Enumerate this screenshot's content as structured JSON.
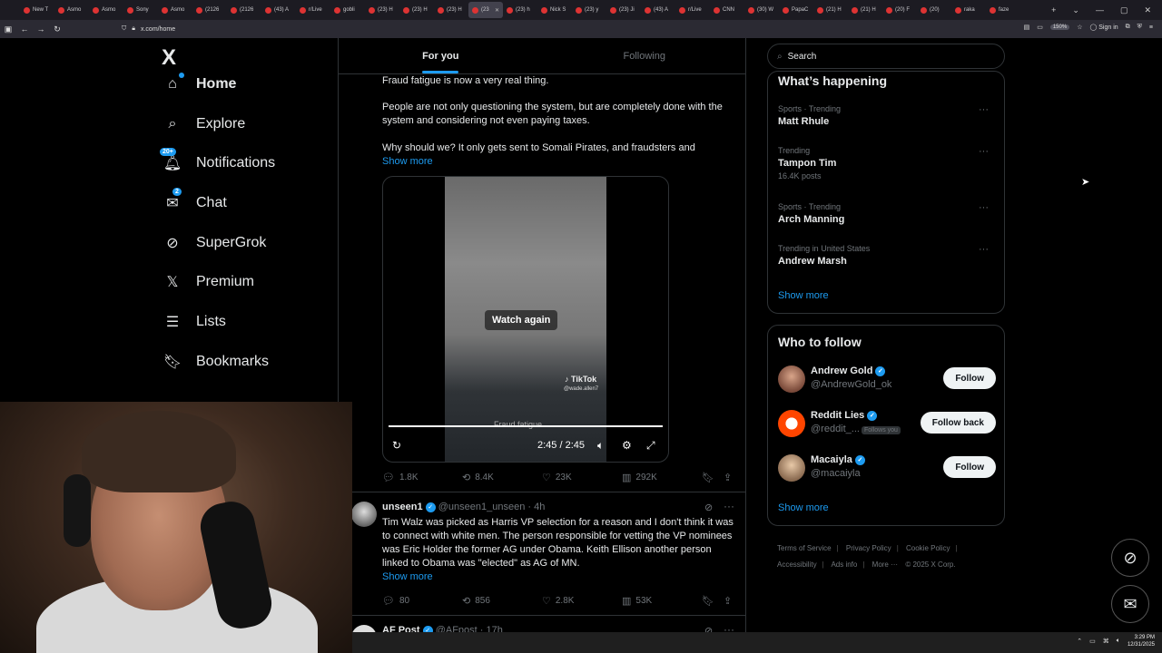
{
  "browser": {
    "tabs": [
      {
        "label": "New T",
        "active": false
      },
      {
        "label": "Asmo",
        "active": false
      },
      {
        "label": "Asmo",
        "active": false
      },
      {
        "label": "Sony",
        "active": false
      },
      {
        "label": "Asmo",
        "active": false
      },
      {
        "label": "(2126",
        "active": false
      },
      {
        "label": "(2126",
        "active": false
      },
      {
        "label": "(43) A",
        "active": false
      },
      {
        "label": "r/Live",
        "active": false
      },
      {
        "label": "gobli",
        "active": false
      },
      {
        "label": "(23) H",
        "active": false
      },
      {
        "label": "(23) H",
        "active": false
      },
      {
        "label": "(23) H",
        "active": false
      },
      {
        "label": "(23",
        "active": true
      },
      {
        "label": "(23) h",
        "active": false
      },
      {
        "label": "Nick S",
        "active": false
      },
      {
        "label": "(23) y",
        "active": false
      },
      {
        "label": "(23) Ji",
        "active": false
      },
      {
        "label": "(43) A",
        "active": false
      },
      {
        "label": "r/Live",
        "active": false
      },
      {
        "label": "CNN",
        "active": false
      },
      {
        "label": "(30) W",
        "active": false
      },
      {
        "label": "PapaC",
        "active": false
      },
      {
        "label": "(21) H",
        "active": false
      },
      {
        "label": "(21) H",
        "active": false
      },
      {
        "label": "(20) F",
        "active": false
      },
      {
        "label": "(20)",
        "active": false
      },
      {
        "label": "raka",
        "active": false
      },
      {
        "label": "faze",
        "active": false
      }
    ],
    "url": "x.com/home",
    "zoom": "150%",
    "sign_in": "Sign in"
  },
  "nav": {
    "logo": "X",
    "items": [
      {
        "label": "Home",
        "icon": "home-icon",
        "glyph": "⌂"
      },
      {
        "label": "Explore",
        "icon": "search-icon",
        "glyph": "⌕"
      },
      {
        "label": "Notifications",
        "icon": "bell-icon",
        "glyph": "🔔︎",
        "badge": "20+"
      },
      {
        "label": "Chat",
        "icon": "mail-icon",
        "glyph": "✉",
        "badge": "2"
      },
      {
        "label": "SuperGrok",
        "icon": "grok-icon",
        "glyph": "⊘"
      },
      {
        "label": "Premium",
        "icon": "x-premium-icon",
        "glyph": "𝕏"
      },
      {
        "label": "Lists",
        "icon": "list-icon",
        "glyph": "☰"
      },
      {
        "label": "Bookmarks",
        "icon": "bookmark-icon",
        "glyph": "🔖︎"
      }
    ]
  },
  "feed": {
    "tabs": [
      "For you",
      "Following"
    ],
    "tweet1": {
      "lines": [
        "Fraud fatigue is now a very real thing.",
        "People are not only questioning the system, but are completely done with the system and considering not even paying taxes.",
        "Why should we? It only gets sent to Somali Pirates, and fraudsters and"
      ],
      "show_more": "Show more",
      "video": {
        "watch_again": "Watch again",
        "caption": "Fraud fatigue.",
        "tiktok": "TikTok",
        "tiktok_handle": "@wade.allen7",
        "time": "2:45 / 2:45"
      },
      "stats": {
        "replies": "1.8K",
        "reposts": "8.4K",
        "likes": "23K",
        "views": "292K"
      }
    },
    "tweet2": {
      "name": "unseen1",
      "handle": "@unseen1_unseen",
      "time": "· 4h",
      "text": "Tim Walz was picked as Harris VP selection for a reason and I don't think it was to connect with white men.   The person responsible for vetting the VP nominees was Eric Holder  the former AG under Obama. Keith Ellison another person linked to Obama was \"elected\" as AG of MN.",
      "show_more": "Show more",
      "stats": {
        "replies": "80",
        "reposts": "856",
        "likes": "2.8K",
        "views": "53K"
      }
    },
    "tweet3": {
      "name": "AF Post",
      "handle": "@AFpost",
      "time": "· 17h"
    }
  },
  "sidebar": {
    "search_placeholder": "Search",
    "whats_happening": {
      "title": "What’s happening",
      "trends": [
        {
          "meta": "Sports · Trending",
          "topic": "Matt Rhule",
          "count": ""
        },
        {
          "meta": "Trending",
          "topic": "Tampon Tim",
          "count": "16.4K posts"
        },
        {
          "meta": "Sports · Trending",
          "topic": "Arch Manning",
          "count": ""
        },
        {
          "meta": "Trending in United States",
          "topic": "Andrew Marsh",
          "count": ""
        }
      ],
      "show_more": "Show more"
    },
    "who_to_follow": {
      "title": "Who to follow",
      "accounts": [
        {
          "name": "Andrew Gold",
          "handle": "@AndrewGold_ok",
          "button": "Follow",
          "follows_you": ""
        },
        {
          "name": "Reddit Lies",
          "handle": "@reddit_...",
          "button": "Follow back",
          "follows_you": "Follows you"
        },
        {
          "name": "Macaiyla",
          "handle": "@macaiyla",
          "button": "Follow",
          "follows_you": ""
        }
      ],
      "show_more": "Show more"
    },
    "footer": {
      "links": [
        "Terms of Service",
        "Privacy Policy",
        "Cookie Policy",
        "Accessibility",
        "Ads info",
        "More ···"
      ],
      "copyright": "© 2025 X Corp."
    }
  },
  "taskbar": {
    "time": "3:29 PM",
    "date": "12/31/2025"
  },
  "colors": {
    "accent": "#1d9bf0",
    "background": "#000000",
    "border": "#2f3336",
    "muted": "#71767b"
  }
}
